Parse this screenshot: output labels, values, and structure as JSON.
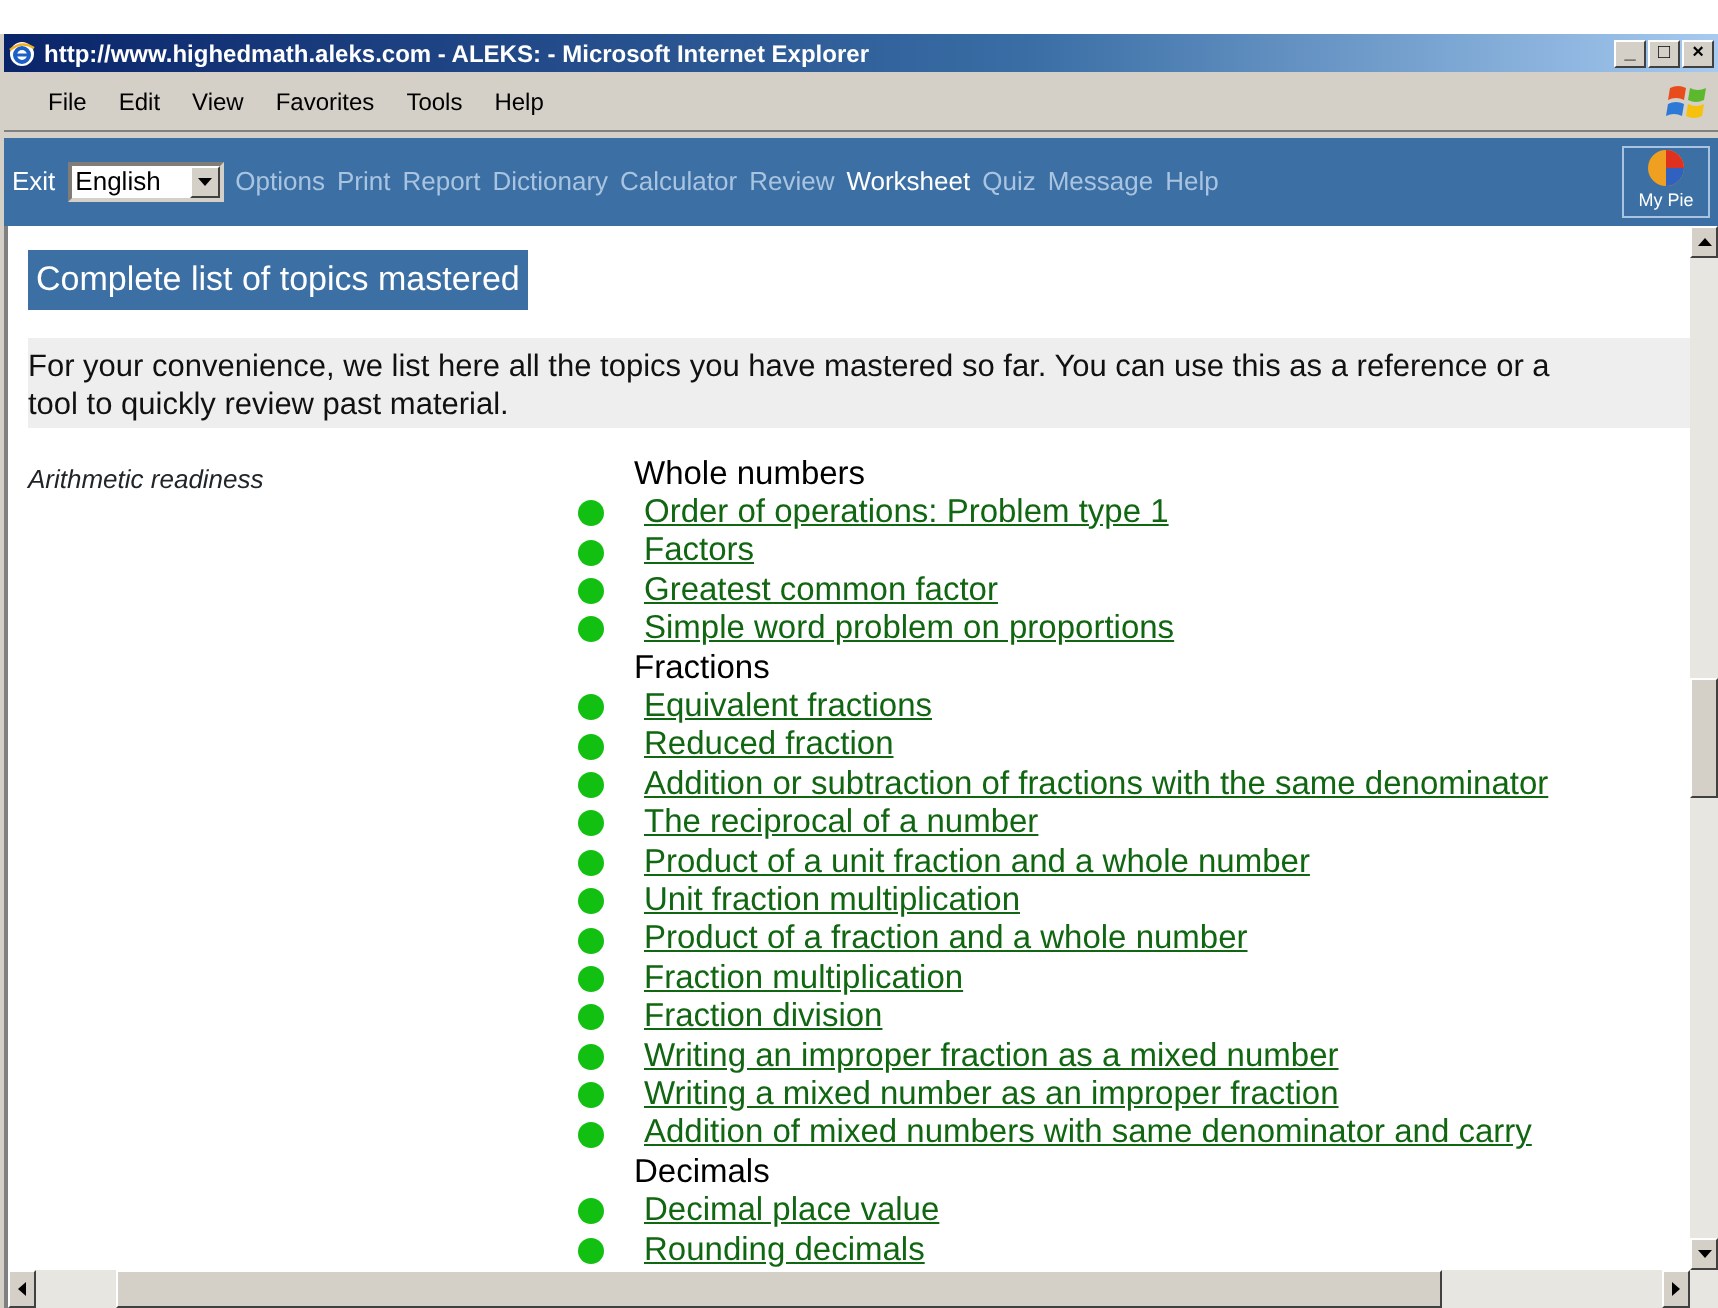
{
  "window": {
    "title": "http://www.highedmath.aleks.com - ALEKS: - Microsoft Internet Explorer",
    "controls": [
      "_",
      "□",
      "×"
    ]
  },
  "menu": [
    "File",
    "Edit",
    "View",
    "Favorites",
    "Tools",
    "Help"
  ],
  "toolbar": {
    "exit": "Exit",
    "language": "English",
    "items": [
      {
        "label": "Options",
        "selected": false
      },
      {
        "label": "Print",
        "selected": false
      },
      {
        "label": "Report",
        "selected": false
      },
      {
        "label": "Dictionary",
        "selected": false
      },
      {
        "label": "Calculator",
        "selected": false
      },
      {
        "label": "Review",
        "selected": false
      },
      {
        "label": "Worksheet",
        "selected": true
      },
      {
        "label": "Quiz",
        "selected": false
      },
      {
        "label": "Message",
        "selected": false
      },
      {
        "label": "Help",
        "selected": false
      }
    ],
    "pie_label": "My Pie"
  },
  "heading": "Complete list of topics mastered",
  "description_lines": [
    "For your convenience, we list here all the topics you have mastered so far. You can use this as a reference or a",
    "tool to quickly review past material."
  ],
  "subject": "Arithmetic readiness",
  "groups": [
    {
      "title": "Whole numbers",
      "topics": [
        "Order of operations: Problem type 1",
        "Factors",
        "Greatest common factor",
        "Simple word problem on proportions"
      ]
    },
    {
      "title": "Fractions",
      "topics": [
        "Equivalent fractions",
        "Reduced fraction",
        "Addition or subtraction of fractions with the same denominator",
        "The reciprocal of a number",
        "Product of a unit fraction and a whole number",
        "Unit fraction multiplication",
        "Product of a fraction and a whole number",
        "Fraction multiplication",
        "Fraction division",
        "Writing an improper fraction as a mixed number",
        "Writing a mixed number as an improper fraction",
        "Addition of mixed numbers with same denominator and carry"
      ]
    },
    {
      "title": "Decimals",
      "topics": [
        "Decimal place value",
        "Rounding decimals"
      ]
    }
  ]
}
